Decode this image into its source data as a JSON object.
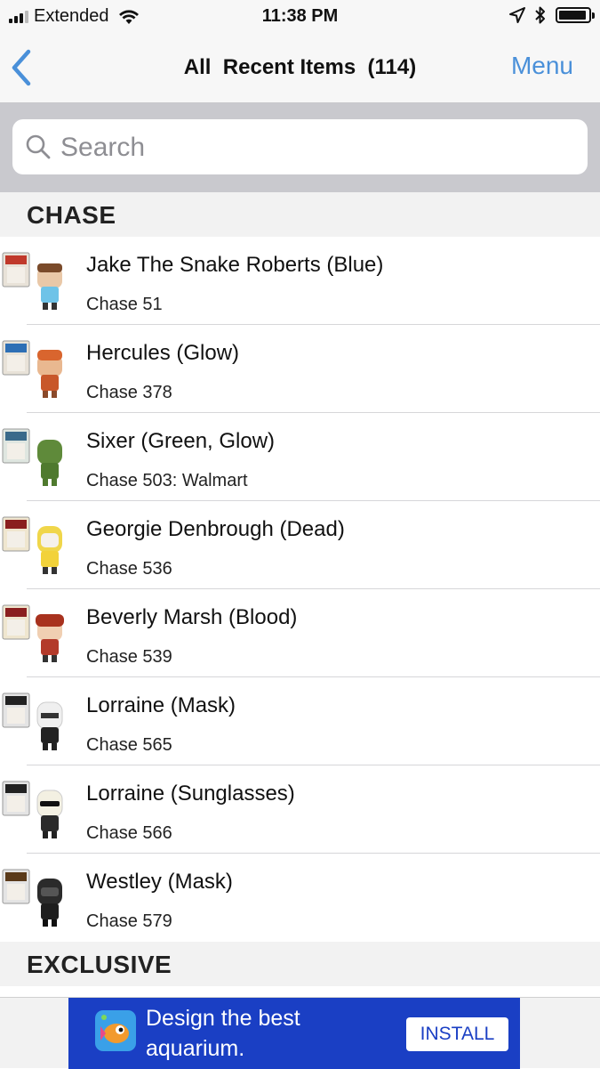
{
  "status_bar": {
    "carrier": "Extended",
    "time": "11:38 PM"
  },
  "nav": {
    "title": "All  Recent Items  (114)",
    "menu_label": "Menu",
    "back_icon": "chevron-left-icon"
  },
  "search": {
    "placeholder": "Search",
    "value": ""
  },
  "sections": [
    {
      "title": "CHASE",
      "items": [
        {
          "title": "Jake The Snake Roberts (Blue)",
          "subtitle": "Chase 51",
          "figure_color": "#7a4a2a",
          "shirt_color": "#6ec3e8"
        },
        {
          "title": "Hercules (Glow)",
          "subtitle": "Chase 378",
          "figure_color": "#d9652e",
          "shirt_color": "#c8572a"
        },
        {
          "title": "Sixer (Green, Glow)",
          "subtitle": "Chase 503: Walmart",
          "figure_color": "#5f8a3a",
          "shirt_color": "#4f7a2e"
        },
        {
          "title": "Georgie Denbrough (Dead)",
          "subtitle": "Chase 536",
          "figure_color": "#f0d64a",
          "shirt_color": "#f2d23a"
        },
        {
          "title": "Beverly Marsh (Blood)",
          "subtitle": "Chase 539",
          "figure_color": "#a8321e",
          "shirt_color": "#b33a2a"
        },
        {
          "title": "Lorraine (Mask)",
          "subtitle": "Chase 565",
          "figure_color": "#efefef",
          "shirt_color": "#222222"
        },
        {
          "title": "Lorraine (Sunglasses)",
          "subtitle": "Chase 566",
          "figure_color": "#f3f0e2",
          "shirt_color": "#2a2a2a"
        },
        {
          "title": "Westley (Mask)",
          "subtitle": "Chase 579",
          "figure_color": "#2b2b2b",
          "shirt_color": "#1e1e1e"
        }
      ]
    },
    {
      "title": "EXCLUSIVE",
      "items": []
    }
  ],
  "ad": {
    "text_line1": "Design the best",
    "text_line2": "aquarium.",
    "button_label": "INSTALL"
  },
  "colors": {
    "accent": "#4a90d9",
    "ad_background": "#1a3fc4"
  }
}
